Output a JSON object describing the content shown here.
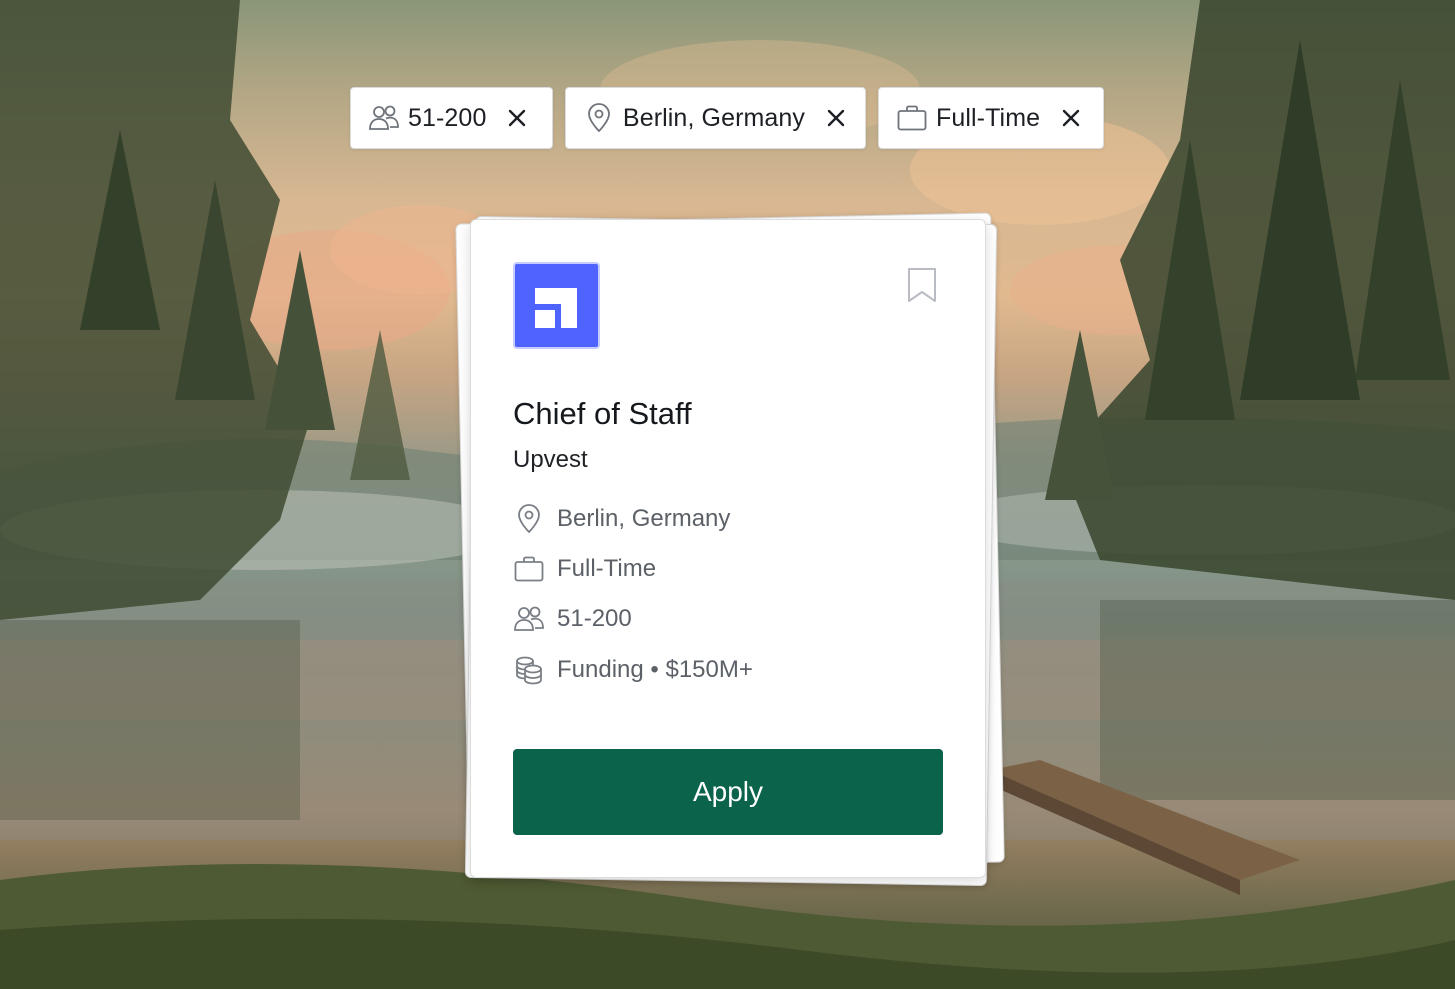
{
  "filters": [
    {
      "icon": "people-icon",
      "label": "51-200"
    },
    {
      "icon": "location-pin-icon",
      "label": "Berlin, Germany"
    },
    {
      "icon": "briefcase-icon",
      "label": "Full-Time"
    }
  ],
  "job": {
    "title": "Chief of Staff",
    "company": "Upvest",
    "logo_color": "#4f63ff",
    "details": {
      "location": "Berlin, Germany",
      "employment_type": "Full-Time",
      "company_size": "51-200",
      "funding": "Funding • $150M+"
    },
    "apply_label": "Apply",
    "apply_color": "#0a634a"
  }
}
